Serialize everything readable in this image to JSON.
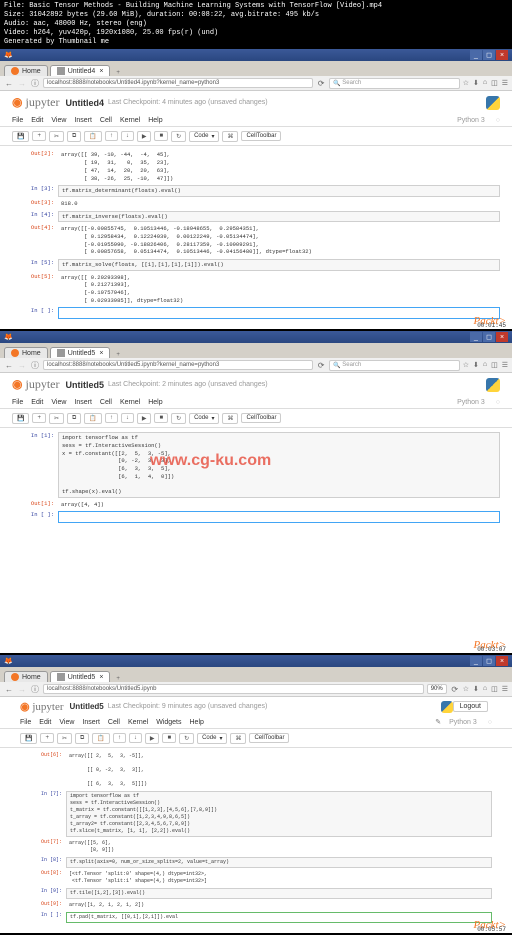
{
  "meta": {
    "l1": "File: Basic Tensor Methods - Building Machine Learning Systems with TensorFlow [Video].mp4",
    "l2": "Size: 31042892 bytes (29.60 MiB), duration: 00:08:22, avg.bitrate: 495 kb/s",
    "l3": "Audio: aac, 48000 Hz, stereo (eng)",
    "l4": "Video: h264, yuv420p, 1920x1080, 25.00 fps(r) (und)",
    "l5": "Generated by Thumbnail me"
  },
  "p1": {
    "tab_home": "Home",
    "tab_title": "Untitled4",
    "url": "localhost:8888/notebooks/Untitled4.ipynb?kernel_name=python3",
    "search_ph": "Search",
    "nb_title": "Untitled4",
    "checkpoint": "Last Checkpoint: 4 minutes ago (unsaved changes)",
    "kernel": "Python 3",
    "celltype": "Code",
    "celltb": "CellToolbar",
    "o2p": "Out[2]:",
    "o2": "array([[ 39, -10, -44,  -4,  45],\n       [ 19,  31,   0,  35,  23],\n       [ 47,  14,  20,  20,  63],\n       [ 38, -26,  25, -10,  47]])",
    "i3p": "In [3]:",
    "i3": "tf.matrix_determinant(floats).eval()",
    "o3p": "Out[3]:",
    "o3": "818.0",
    "i4p": "In [4]:",
    "i4": "tf.matrix_inverse(floats).eval()",
    "o4p": "Out[4]:",
    "o4": "array([[-0.00855745,  0.10513446, -0.18948655,  0.29584351],\n       [ 0.12958434,  0.12224939,  0.00122249, -0.05134474],\n       [-0.01955990, -0.18826406,  0.28117359, -0.10909291],\n       [ 0.00857658,  0.05134474,  0.10513446, -0.04156480]], dtype=float32)",
    "i5p": "In [5]:",
    "i5": "tf.matrix_solve(floats, [[1],[1],[1],[1]]).eval()",
    "o5p": "Out[5]:",
    "o5": "array([[ 0.20293398],\n       [ 0.21271393],\n       [-0.10757946],\n       [ 0.02933985]], dtype=float32)",
    "iempp": "In [ ]:",
    "ts": "00:01:45"
  },
  "p2": {
    "tab_home": "Home",
    "tab_title": "Untitled5",
    "url": "localhost:8888/notebooks/Untitled5.ipynb?kernel_name=python3",
    "search_ph": "Search",
    "nb_title": "Untitled5",
    "checkpoint": "Last Checkpoint: 2 minutes ago (unsaved changes)",
    "kernel": "Python 3",
    "celltype": "Code",
    "celltb": "CellToolbar",
    "i1p": "In [1]:",
    "i1": "import tensorflow as tf\nsess = tf.InteractiveSession()\nx = tf.constant([[2,  5,  3, -5],\n                 [0, -2,  3,  3],\n                 [6,  3,  3,  5],\n                 [6,  1,  4,  0]])\n\ntf.shape(x).eval()",
    "o1p": "Out[1]:",
    "o1": "array([4, 4])",
    "iempp": "In [ ]:",
    "watermark": "www.cg-ku.com",
    "ts": "00:03:07"
  },
  "p3": {
    "tab_home": "Home",
    "tab_title": "Untitled5",
    "url": "localhost:8888/notebooks/Untitled5.ipynb",
    "zoom": "90%",
    "nb_title": "Untitled5",
    "checkpoint": "Last Checkpoint: 9 minutes ago (unsaved changes)",
    "logout": "Logout",
    "kernel": "Python 3",
    "celltype": "Code",
    "celltb": "CellToolbar",
    "o6p": "Out[6]:",
    "o6": "array([[ 2,  5,  3, -5]],\n\n      [[ 0, -2,  3,  3]],\n\n      [[ 6,  3,  3,  5]]])",
    "i7p": "In [7]:",
    "i7": "import tensorflow as tf\nsess = tf.InteractiveSession()\nt_matrix = tf.constant([[1,2,3],[4,5,6],[7,8,9]])\nt_array = tf.constant([1,2,3,4,9,8,6,5])\nt_array2= tf.constant([2,3,4,5,6,7,8,9])\ntf.slice(t_matrix, [1, 1], [2,2]).eval()",
    "o7p": "Out[7]:",
    "o7": "array([[5, 6],\n       [8, 9]])",
    "i8p": "In [8]:",
    "i8": "tf.split(axis=0, num_or_size_splits=2, value=t_array)",
    "o8p": "Out[8]:",
    "o8": "[<tf.Tensor 'split:0' shape=(4,) dtype=int32>,\n <tf.Tensor 'split:1' shape=(4,) dtype=int32>]",
    "i9p": "In [9]:",
    "i9": "tf.tile([1,2],[3]).eval()",
    "o9p": "Out[9]:",
    "o9": "array([1, 2, 1, 2, 1, 2])",
    "iempp": "In [ ]:",
    "iemp": "tf.pad(t_matrix, [[0,1],[2,1]]).eval",
    "ts": "00:05:57"
  },
  "menu": {
    "file": "File",
    "edit": "Edit",
    "view": "View",
    "insert": "Insert",
    "cell": "Cell",
    "kernel": "Kernel",
    "widgets": "Widgets",
    "help": "Help"
  },
  "packt": "Packt>"
}
